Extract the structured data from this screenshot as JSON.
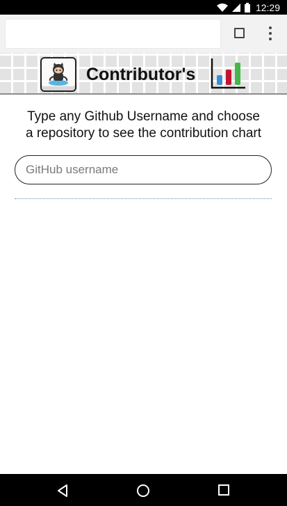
{
  "status_bar": {
    "time": "12:29",
    "icons": [
      "wifi-icon",
      "signal-icon",
      "battery-icon"
    ]
  },
  "browser": {
    "url_value": "",
    "icons": [
      "tabs-icon",
      "overflow-menu-icon"
    ]
  },
  "header": {
    "title": "Contributor's",
    "logo_icon": "github-octocat-icon",
    "chart_icon": "bar-chart-icon"
  },
  "intro": {
    "line1": "Type any Github Username and choose",
    "line2": "a repository to see the contribution chart"
  },
  "search": {
    "placeholder": "GitHub username",
    "value": ""
  },
  "nav_bar": {
    "icons": [
      "back-icon",
      "home-icon",
      "recents-icon"
    ]
  },
  "colors": {
    "status_bar": "#000000",
    "toolbar": "#f2f2f2",
    "chart_blue": "#3a8fd1",
    "chart_red": "#c0152f",
    "chart_green": "#47b549"
  }
}
